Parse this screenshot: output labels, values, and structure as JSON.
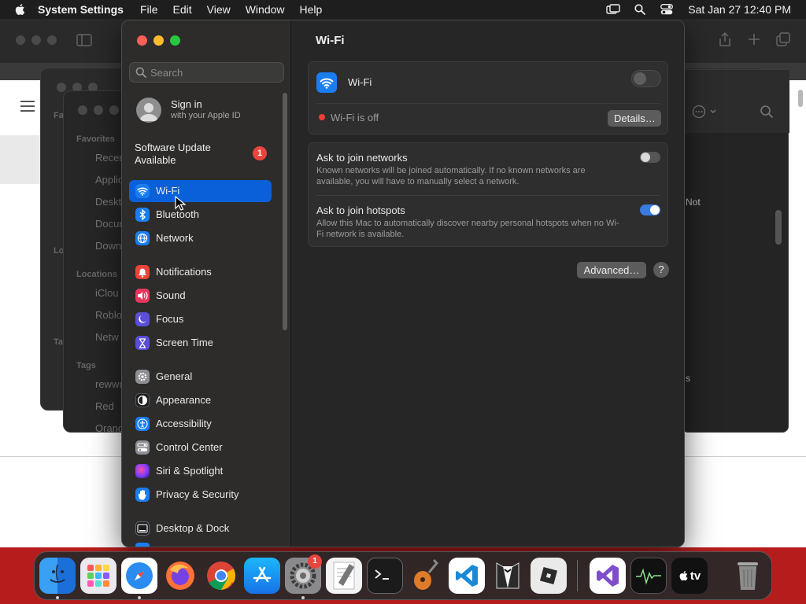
{
  "menubar": {
    "app_name": "System Settings",
    "menus": [
      "File",
      "Edit",
      "View",
      "Window",
      "Help"
    ],
    "clock": "Sat Jan 27  12:40 PM"
  },
  "background": {
    "finder_favorites_header": "Favorites",
    "finder_items": [
      "Recen",
      "Applic",
      "Deskt",
      "Docum",
      "Down"
    ],
    "finder_locations_header": "Locations",
    "finder_location_items": [
      "iClou",
      "Roblo",
      "Netw"
    ],
    "finder_tags_header": "Tags",
    "finder_tag_items": [
      "rewwı",
      "Red",
      "Orang"
    ],
    "back_window_fragments": [
      "Fa",
      "Lo",
      "Ta"
    ],
    "right_window_fragments": [
      "Not",
      "s"
    ]
  },
  "settings": {
    "search_placeholder": "Search",
    "sign_in": {
      "title": "Sign in",
      "subtitle": "with your Apple ID"
    },
    "software_update": {
      "label": "Software Update Available",
      "badge": "1"
    },
    "sidebar": [
      {
        "label": "Wi-Fi",
        "selected": true
      },
      {
        "label": "Bluetooth"
      },
      {
        "label": "Network"
      },
      {
        "label": "Notifications"
      },
      {
        "label": "Sound"
      },
      {
        "label": "Focus"
      },
      {
        "label": "Screen Time"
      },
      {
        "label": "General"
      },
      {
        "label": "Appearance"
      },
      {
        "label": "Accessibility"
      },
      {
        "label": "Control Center"
      },
      {
        "label": "Siri & Spotlight"
      },
      {
        "label": "Privacy & Security"
      },
      {
        "label": "Desktop & Dock"
      }
    ],
    "content": {
      "title": "Wi-Fi",
      "wifi_label": "Wi-Fi",
      "wifi_enabled": false,
      "status_text": "Wi-Fi is off",
      "details_button": "Details…",
      "ask_networks": {
        "title": "Ask to join networks",
        "description": "Known networks will be joined automatically. If no known networks are available, you will have to manually select a network.",
        "enabled": false
      },
      "ask_hotspots": {
        "title": "Ask to join hotspots",
        "description": "Allow this Mac to automatically discover nearby personal hotspots when no Wi-Fi network is available.",
        "enabled": true
      },
      "advanced_button": "Advanced…",
      "help_button": "?"
    }
  },
  "dock": {
    "apps": [
      "Finder",
      "Launchpad",
      "Safari",
      "Firefox",
      "Chrome",
      "App Store",
      "System Settings",
      "TextEdit",
      "Terminal",
      "GarageBand",
      "Visual Studio Code",
      "Tuxedo",
      "Roblox",
      "Visual Studio",
      "Activity Monitor",
      "Apple TV",
      "Trash"
    ],
    "system_settings_badge": "1",
    "apple_tv_label": "tv"
  },
  "colors": {
    "accent": "#0a60d8",
    "toggle_on": "#3a7ce0",
    "status_off": "#ee3f36",
    "desktop": "#b51d1d"
  }
}
